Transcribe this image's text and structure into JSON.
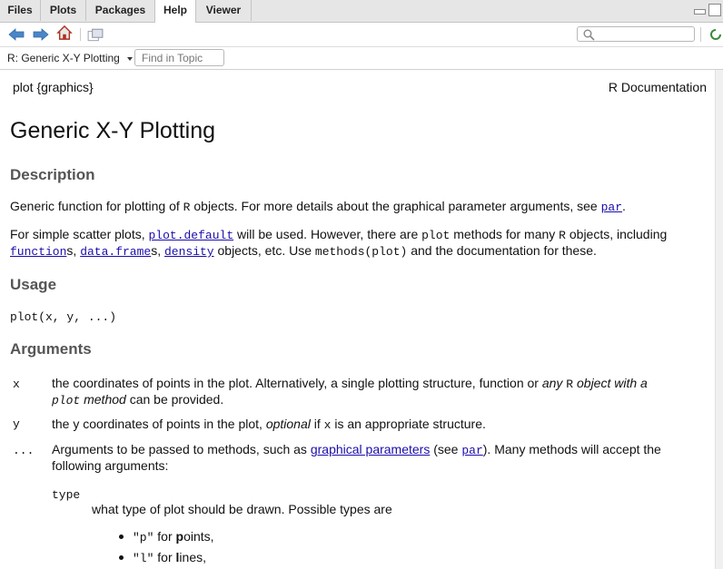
{
  "tabs": [
    "Files",
    "Plots",
    "Packages",
    "Help",
    "Viewer"
  ],
  "active_tab": "Help",
  "topic_selector": "R: Generic X-Y Plotting",
  "find_in_topic_placeholder": "Find in Topic",
  "doc": {
    "package": "plot {graphics}",
    "rdoc": "R Documentation",
    "title": "Generic X-Y Plotting",
    "description_heading": "Description",
    "desc1": {
      "a": "Generic function for plotting of ",
      "code": "R",
      "b": " objects. For more details about the graphical parameter arguments, see ",
      "link": "par",
      "c": "."
    },
    "desc2": {
      "a": "For simple scatter plots, ",
      "link1": "plot.default",
      "b": " will be used. However, there are ",
      "code1": "plot",
      "c": " methods for many ",
      "code2": "R",
      "d": " objects, including",
      "link2": "function",
      "e": "s, ",
      "link3": "data.frame",
      "f": "s, ",
      "link4": "density",
      "g": " objects, etc. Use ",
      "code3": "methods(plot)",
      "h": " and the documentation for these."
    },
    "usage_heading": "Usage",
    "usage_code": "plot(x, y, ...)",
    "arguments_heading": "Arguments",
    "args": {
      "x_name": "x",
      "x_a": "the coordinates of points in the plot. Alternatively, a single plotting structure, function or ",
      "x_em1": "any ",
      "x_code": "R",
      "x_em2": " object with a",
      "x_code2": "plot",
      "x_em3": " method",
      "x_b": " can be provided.",
      "y_name": "y",
      "y_a": "the y coordinates of points in the plot, ",
      "y_em": "optional",
      "y_b": " if ",
      "y_code": "x",
      "y_c": " is an appropriate structure.",
      "dots_name": "...",
      "dots_a": "Arguments to be passed to methods, such as ",
      "dots_link1": "graphical parameters",
      "dots_b": " (see ",
      "dots_link2": "par",
      "dots_c": "). Many methods will accept the",
      "dots_line2": "following arguments:",
      "type_name": "type",
      "type_desc": "what type of plot should be drawn. Possible types are",
      "bullets": [
        {
          "code": "\"p\"",
          "pre": " for ",
          "bold": "p",
          "post": "oints,"
        },
        {
          "code": "\"l\"",
          "pre": " for ",
          "bold": "l",
          "post": "ines,"
        }
      ]
    }
  }
}
